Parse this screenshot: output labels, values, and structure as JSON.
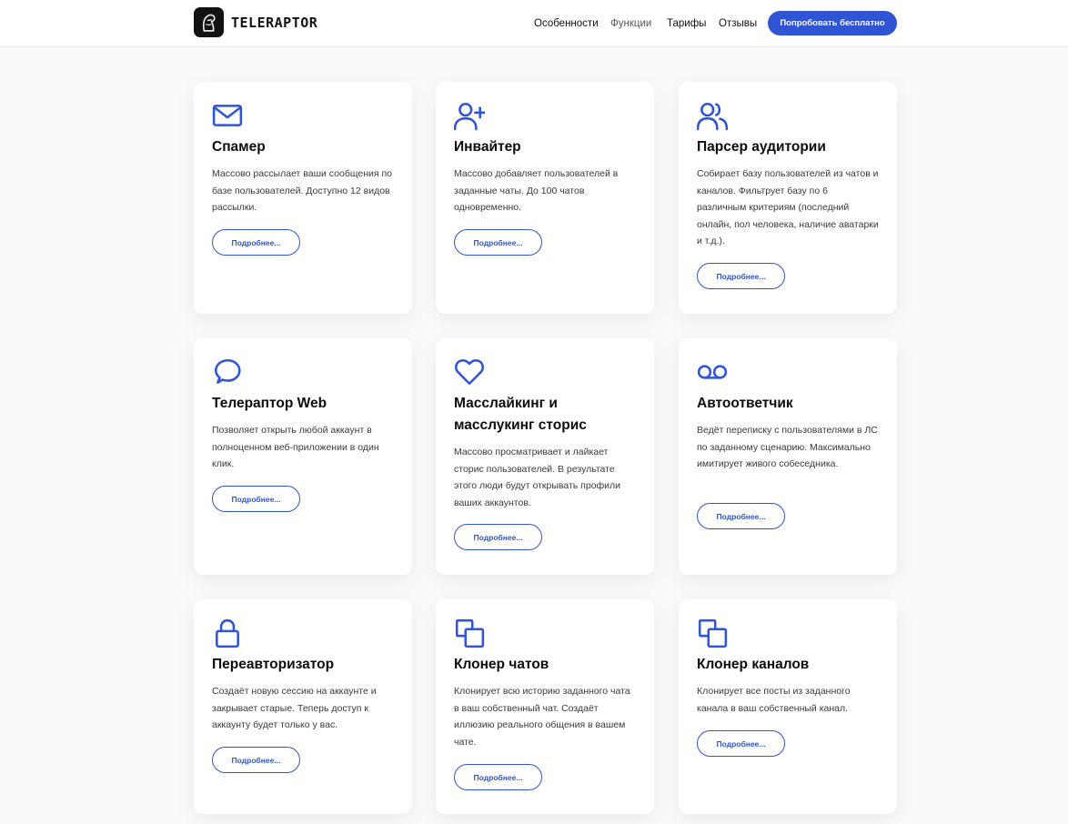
{
  "header": {
    "brand": "TELERAPTOR",
    "nav": [
      "Особенности",
      "Функции",
      "Тарифы",
      "Отзывы"
    ],
    "cta_label": "Попробовать бесплатно"
  },
  "colors": {
    "accent": "#2f55d4",
    "card_bg": "#ffffff",
    "page_bg": "#fafafa",
    "text": "#111111"
  },
  "features": [
    {
      "icon": "mail-icon",
      "title": "Спамер",
      "description": "Массово рассылает ваши сообщения по базе пользователей. Доступно 12 видов рассылки.",
      "button": "Подробнее..."
    },
    {
      "icon": "user-plus-icon",
      "title": "Инвайтер",
      "description": "Массово добавляет пользователей в заданные чаты. До 100 чатов одновременно.",
      "button": "Подробнее..."
    },
    {
      "icon": "users-icon",
      "title": "Парсер аудитории",
      "description": "Собирает базу пользователей из чатов и каналов. Фильтрует базу по 6 различным критериям (последний онлайн, пол человека, наличие аватарки и т.д.).",
      "button": "Подробнее..."
    },
    {
      "icon": "chat-bubble-icon",
      "title": "Телераптор Web",
      "description": "Позволяет открыть любой аккаунт в полноценном веб-приложении в один клик.",
      "button": "Подробнее..."
    },
    {
      "icon": "heart-icon",
      "title": "Масслайкинг и масслукинг сторис",
      "description": "Массово просматривает и лайкает сторис пользователей. В результате этого люди будут открывать профили ваших аккаунтов.",
      "button": "Подробнее..."
    },
    {
      "icon": "voicemail-icon",
      "title": "Автоответчик",
      "description": "Ведёт переписку с пользователями в ЛС по заданному сценарию. Максимально имитирует живого собеседника.",
      "button": "Подробнее..."
    },
    {
      "icon": "lock-icon",
      "title": "Переавторизатор",
      "description": "Создаёт новую сессию на аккаунте и закрывает старые. Теперь доступ к аккаунту будет только у вас.",
      "button": "Подробнее..."
    },
    {
      "icon": "copy-icon",
      "title": "Клонер чатов",
      "description": "Клонирует всю историю заданного чата в ваш собственный чат. Создаёт иллюзию реального общения в вашем чате.",
      "button": "Подробнее..."
    },
    {
      "icon": "copy-icon",
      "title": "Клонер каналов",
      "description": "Клонирует все посты из заданного канала в ваш собственный канал.",
      "button": "Подробнее..."
    }
  ]
}
